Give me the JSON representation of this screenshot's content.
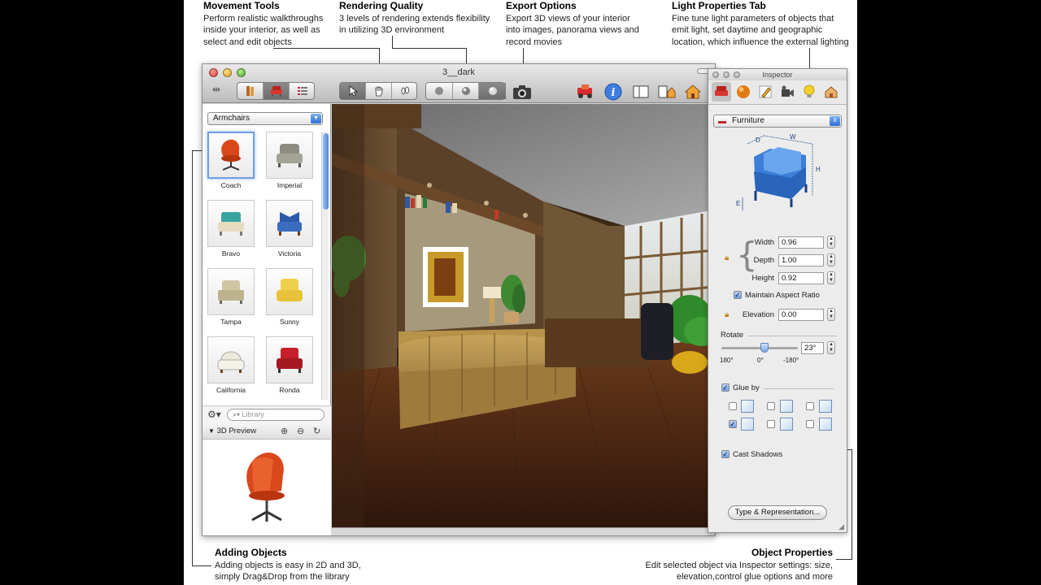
{
  "annotations": {
    "movement": {
      "title": "Movement Tools",
      "line1": "Perform realistic walkthroughs",
      "line2": "inside your interior, as well as",
      "line3": "select and edit objects"
    },
    "rendering": {
      "title": "Rendering Quality",
      "line1": "3 levels of rendering extends flexibility",
      "line2": "in utilizing 3D environment"
    },
    "export": {
      "title": "Export Options",
      "line1": "Export 3D views of your interior",
      "line2": "into images, panorama views and",
      "line3": "record movies"
    },
    "light": {
      "title": "Light Properties Tab",
      "line1": "Fine tune light parameters of objects that",
      "line2": "emit light, set daytime and geographic",
      "line3": "location, which influence the external lighting"
    },
    "adding": {
      "title": "Adding Objects",
      "line1": "Adding objects is easy in 2D and 3D,",
      "line2": "simply Drag&Drop from the library"
    },
    "objprops": {
      "title": "Object Properties",
      "line1": "Edit selected object via Inspector settings: size,",
      "line2": "elevation,control glue options and more"
    }
  },
  "window": {
    "title": "3__dark"
  },
  "library": {
    "category": "Armchairs",
    "items": [
      {
        "label": "Coach",
        "color": "#d9481a"
      },
      {
        "label": "Imperial",
        "color": "#8c8c80"
      },
      {
        "label": "Bravo",
        "color": "#39a3a0"
      },
      {
        "label": "Victoria",
        "color": "#2c5aa8"
      },
      {
        "label": "Tampa",
        "color": "#cfc6a4"
      },
      {
        "label": "Sunny",
        "color": "#f0cf4a"
      },
      {
        "label": "California",
        "color": "#ece8dc"
      },
      {
        "label": "Ronda",
        "color": "#c5202c"
      }
    ],
    "search_placeholder": "Library",
    "preview_title": "3D Preview"
  },
  "inspector": {
    "title": "Inspector",
    "category": "Furniture",
    "dims": {
      "d": "D",
      "w": "W",
      "h": "H",
      "e": "E"
    },
    "width_label": "Width",
    "width": "0.96",
    "depth_label": "Depth",
    "depth": "1.00",
    "height_label": "Height",
    "height": "0.92",
    "maintain_label": "Maintain Aspect Ratio",
    "elevation_label": "Elevation",
    "elevation": "0.00",
    "rotate_label": "Rotate",
    "rotate": "23°",
    "rotate_ticks": [
      "180°",
      "0°",
      "-180°"
    ],
    "rotate_fraction": 0.56,
    "glue_label": "Glue by",
    "shadows_label": "Cast Shadows",
    "type_button": "Type & Representation..."
  },
  "colors": {
    "accent": "#3a76d6",
    "armchair": "#d9481a"
  }
}
